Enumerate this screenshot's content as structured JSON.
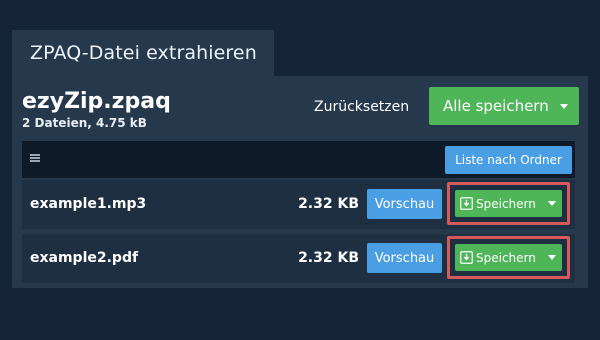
{
  "dialog": {
    "tab_label": "ZPAQ-Datei extrahieren"
  },
  "archive": {
    "name": "ezyZip.zpaq",
    "summary": "2 Dateien, 4.75 kB"
  },
  "toolbar": {
    "reset_label": "Zurücksetzen",
    "save_all_label": "Alle speichern"
  },
  "list_header": {
    "sort_label": "Liste nach Ordner"
  },
  "files": [
    {
      "name": "example1.mp3",
      "size": "2.32 KB",
      "preview_label": "Vorschau",
      "save_label": "Speichern"
    },
    {
      "name": "example2.pdf",
      "size": "2.32 KB",
      "preview_label": "Vorschau",
      "save_label": "Speichern"
    }
  ],
  "icons": {
    "menu": "hamburger-menu-icon",
    "download": "download-icon",
    "dropdown": "chevron-down-icon"
  },
  "colors": {
    "background": "#152436",
    "panel": "#26394c",
    "header_bar": "#0f1a28",
    "row": "#1d2f41",
    "primary_blue": "#4a9ee3",
    "success_green": "#4fb559",
    "highlight_red": "#d6595b"
  }
}
